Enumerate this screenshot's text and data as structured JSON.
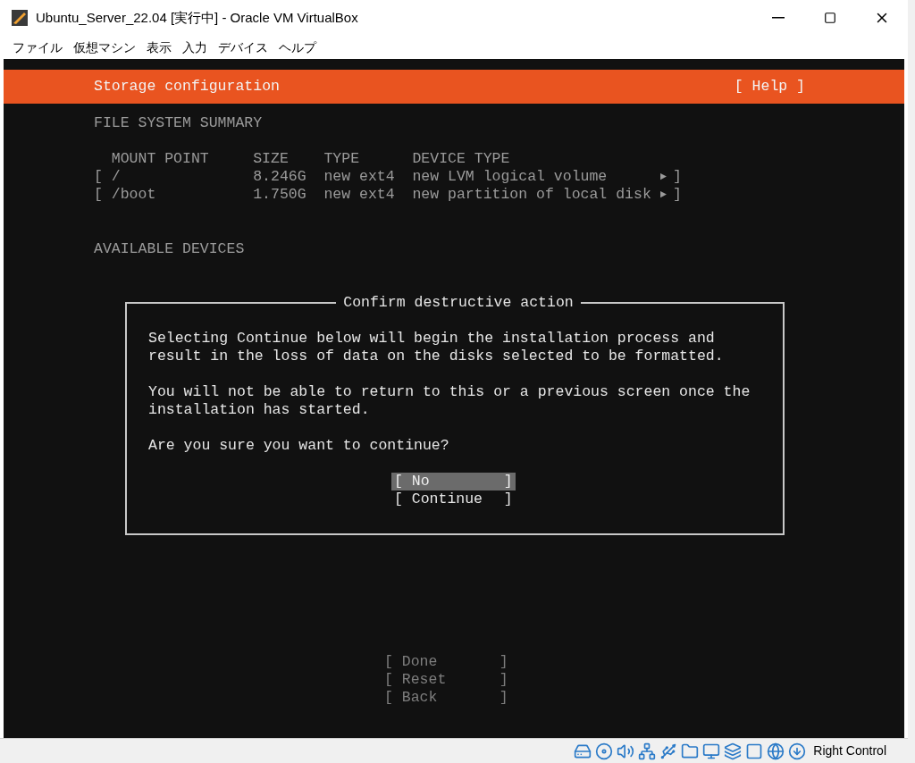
{
  "window": {
    "title": "Ubuntu_Server_22.04 [実行中] - Oracle VM VirtualBox"
  },
  "menu": [
    "ファイル",
    "仮想マシン",
    "表示",
    "入力",
    "デバイス",
    "ヘルプ"
  ],
  "header": {
    "title": "Storage configuration",
    "help": "[ Help ]"
  },
  "summary": {
    "heading": "FILE SYSTEM SUMMARY",
    "columns": [
      "MOUNT POINT",
      "SIZE",
      "TYPE",
      "DEVICE TYPE"
    ],
    "rows": [
      {
        "open": "[",
        "mount_point": "/",
        "size": "8.246G",
        "type": "new ext4",
        "device_type": "new LVM logical volume",
        "arrow": "►",
        "close": "]"
      },
      {
        "open": "[",
        "mount_point": "/boot",
        "size": "1.750G",
        "type": "new ext4",
        "device_type": "new partition of local disk",
        "arrow": "►",
        "close": "]"
      }
    ]
  },
  "available_heading": "AVAILABLE DEVICES",
  "dialog": {
    "title": "Confirm destructive action",
    "paragraphs": [
      "Selecting Continue below will begin the installation process and result in the loss of data on the disks selected to be formatted.",
      "You will not be able to return to this or a previous screen once the installation has started.",
      "Are you sure you want to continue?"
    ],
    "buttons": [
      {
        "open": "[",
        "label": "No",
        "close": "]",
        "selected": true
      },
      {
        "open": "[",
        "label": "Continue",
        "close": "]",
        "selected": false
      }
    ]
  },
  "actions": [
    {
      "open": "[",
      "label": "Done",
      "close": "]"
    },
    {
      "open": "[",
      "label": "Reset",
      "close": "]"
    },
    {
      "open": "[",
      "label": "Back",
      "close": "]"
    }
  ],
  "status_bar": {
    "host_key": "Right Control"
  }
}
